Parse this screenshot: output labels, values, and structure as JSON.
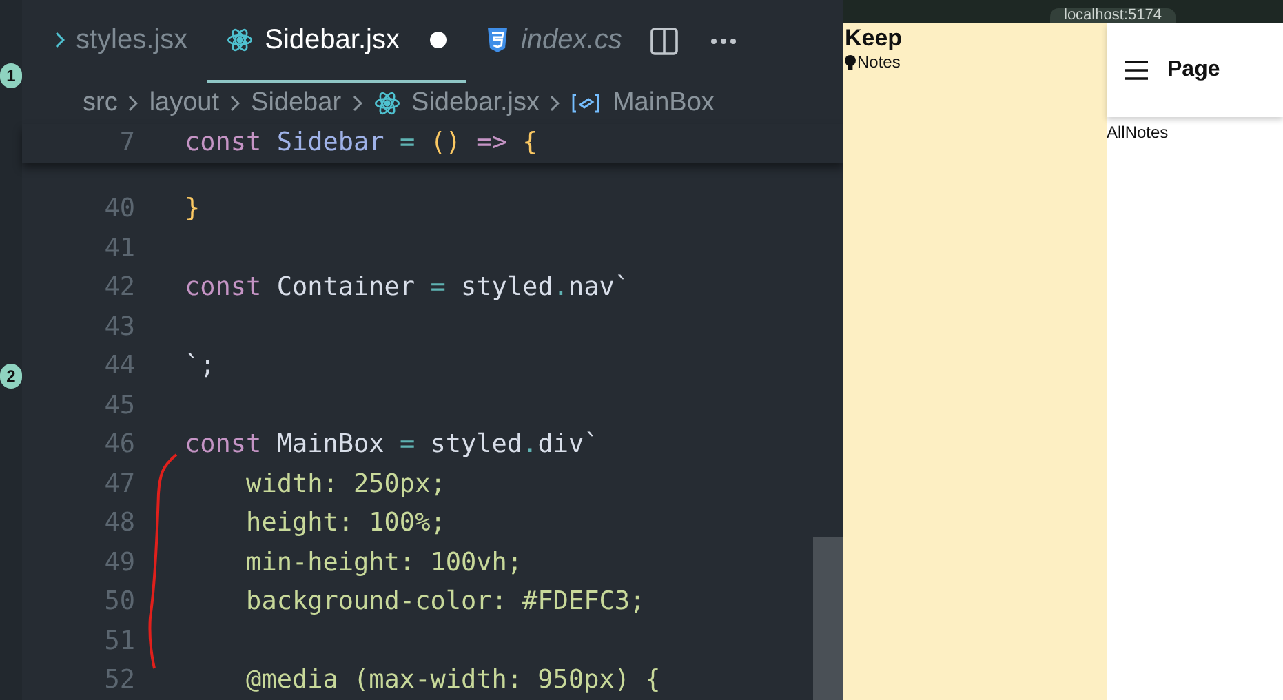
{
  "activity_bar": {
    "badges": [
      "1",
      "2"
    ]
  },
  "tabs": [
    {
      "label": "styles.jsx",
      "kind": "folder",
      "selected": false,
      "italic": false
    },
    {
      "label": "Sidebar.jsx",
      "kind": "react",
      "selected": true,
      "italic": false,
      "modified": true
    },
    {
      "label": "index.cs",
      "kind": "css",
      "selected": false,
      "italic": true
    }
  ],
  "breadcrumbs": [
    {
      "label": "src",
      "kind": "folder"
    },
    {
      "label": "layout",
      "kind": "folder"
    },
    {
      "label": "Sidebar",
      "kind": "folder"
    },
    {
      "label": "Sidebar.jsx",
      "kind": "react"
    },
    {
      "label": "MainBox",
      "kind": "symbol"
    }
  ],
  "sticky_line": {
    "number": "7",
    "tokens": [
      {
        "text": "const ",
        "kind": "keyword"
      },
      {
        "text": "Sidebar ",
        "kind": "function"
      },
      {
        "text": "= ",
        "kind": "operator"
      },
      {
        "text": "() ",
        "kind": "brace"
      },
      {
        "text": "=> ",
        "kind": "keyword"
      },
      {
        "text": "{",
        "kind": "brace"
      }
    ]
  },
  "lines": [
    {
      "number": "40",
      "tokens": [
        {
          "text": "}",
          "kind": "brace"
        }
      ]
    },
    {
      "number": "41"
    },
    {
      "number": "42",
      "tokens": [
        {
          "text": "const ",
          "kind": "keyword"
        },
        {
          "text": "Container ",
          "kind": "plain"
        },
        {
          "text": "= ",
          "kind": "operator"
        },
        {
          "text": "styled",
          "kind": "plain"
        },
        {
          "text": ".",
          "kind": "operator"
        },
        {
          "text": "nav`",
          "kind": "plain"
        }
      ]
    },
    {
      "number": "43"
    },
    {
      "number": "44",
      "tokens": [
        {
          "text": "`;",
          "kind": "plain"
        }
      ]
    },
    {
      "number": "45"
    },
    {
      "number": "46",
      "tokens": [
        {
          "text": "const ",
          "kind": "keyword"
        },
        {
          "text": "MainBox ",
          "kind": "plain"
        },
        {
          "text": "= ",
          "kind": "operator"
        },
        {
          "text": "styled",
          "kind": "plain"
        },
        {
          "text": ".",
          "kind": "operator"
        },
        {
          "text": "div`",
          "kind": "plain"
        }
      ]
    },
    {
      "number": "47",
      "tokens": [
        {
          "text": "    width: 250px;",
          "kind": "string"
        }
      ]
    },
    {
      "number": "48",
      "tokens": [
        {
          "text": "    height: 100%;",
          "kind": "string"
        }
      ]
    },
    {
      "number": "49",
      "tokens": [
        {
          "text": "    min-height: 100vh;",
          "kind": "string"
        }
      ]
    },
    {
      "number": "50",
      "tokens": [
        {
          "text": "    background-color: #FDEFC3;",
          "kind": "string"
        }
      ]
    },
    {
      "number": "51"
    },
    {
      "number": "52",
      "tokens": [
        {
          "text": "    @media (max-width: 950px) {",
          "kind": "string"
        }
      ]
    }
  ],
  "browser": {
    "address": "localhost:5174",
    "sidebar": {
      "title": "Keep",
      "items": [
        {
          "label": "Notes"
        }
      ]
    },
    "header": {
      "title": "Page"
    },
    "content": "AllNotes"
  }
}
